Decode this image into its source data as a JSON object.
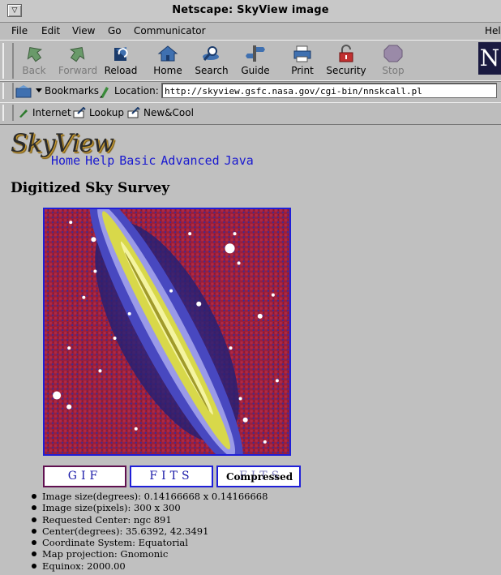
{
  "window": {
    "title": "Netscape: SkyView image"
  },
  "menu": [
    "File",
    "Edit",
    "View",
    "Go",
    "Communicator",
    "Hel"
  ],
  "toolbar": [
    {
      "label": "Back",
      "icon": "back-arrow-icon",
      "enabled": false
    },
    {
      "label": "Forward",
      "icon": "forward-arrow-icon",
      "enabled": false
    },
    {
      "label": "Reload",
      "icon": "reload-icon",
      "enabled": true
    },
    {
      "label": "Home",
      "icon": "home-icon",
      "enabled": true
    },
    {
      "label": "Search",
      "icon": "search-icon",
      "enabled": true
    },
    {
      "label": "Guide",
      "icon": "guide-icon",
      "enabled": true
    },
    {
      "label": "Print",
      "icon": "print-icon",
      "enabled": true
    },
    {
      "label": "Security",
      "icon": "lock-icon",
      "enabled": true
    },
    {
      "label": "Stop",
      "icon": "stop-icon",
      "enabled": false
    }
  ],
  "locationbar": {
    "bookmarks_label": "Bookmarks",
    "location_label": "Location:",
    "url": "http://skyview.gsfc.nasa.gov/cgi-bin/nnskcall.pl"
  },
  "personal": [
    "Internet",
    "Lookup",
    "New&Cool"
  ],
  "page": {
    "logo": "SkyView",
    "nav": [
      "Home",
      "Help",
      "Basic",
      "Advanced",
      "Java"
    ],
    "heading": "Digitized Sky Survey",
    "buttons": {
      "gif": "GIF",
      "fits": "FITS",
      "compressed_back": "FITS",
      "compressed_front": "Compressed"
    },
    "info": [
      "Image size(degrees): 0.14166668 x 0.14166668",
      "Image size(pixels): 300 x 300",
      "Requested Center: ngc 891",
      "Center(degrees): 35.6392, 42.3491",
      "Coordinate System: Equatorial",
      "Map projection: Gnomonic",
      "Equinox: 2000.00"
    ]
  },
  "colors": {
    "link": "#1a1ad0",
    "image_border": "#1f1fd8",
    "chrome": "#bdbdbd"
  }
}
